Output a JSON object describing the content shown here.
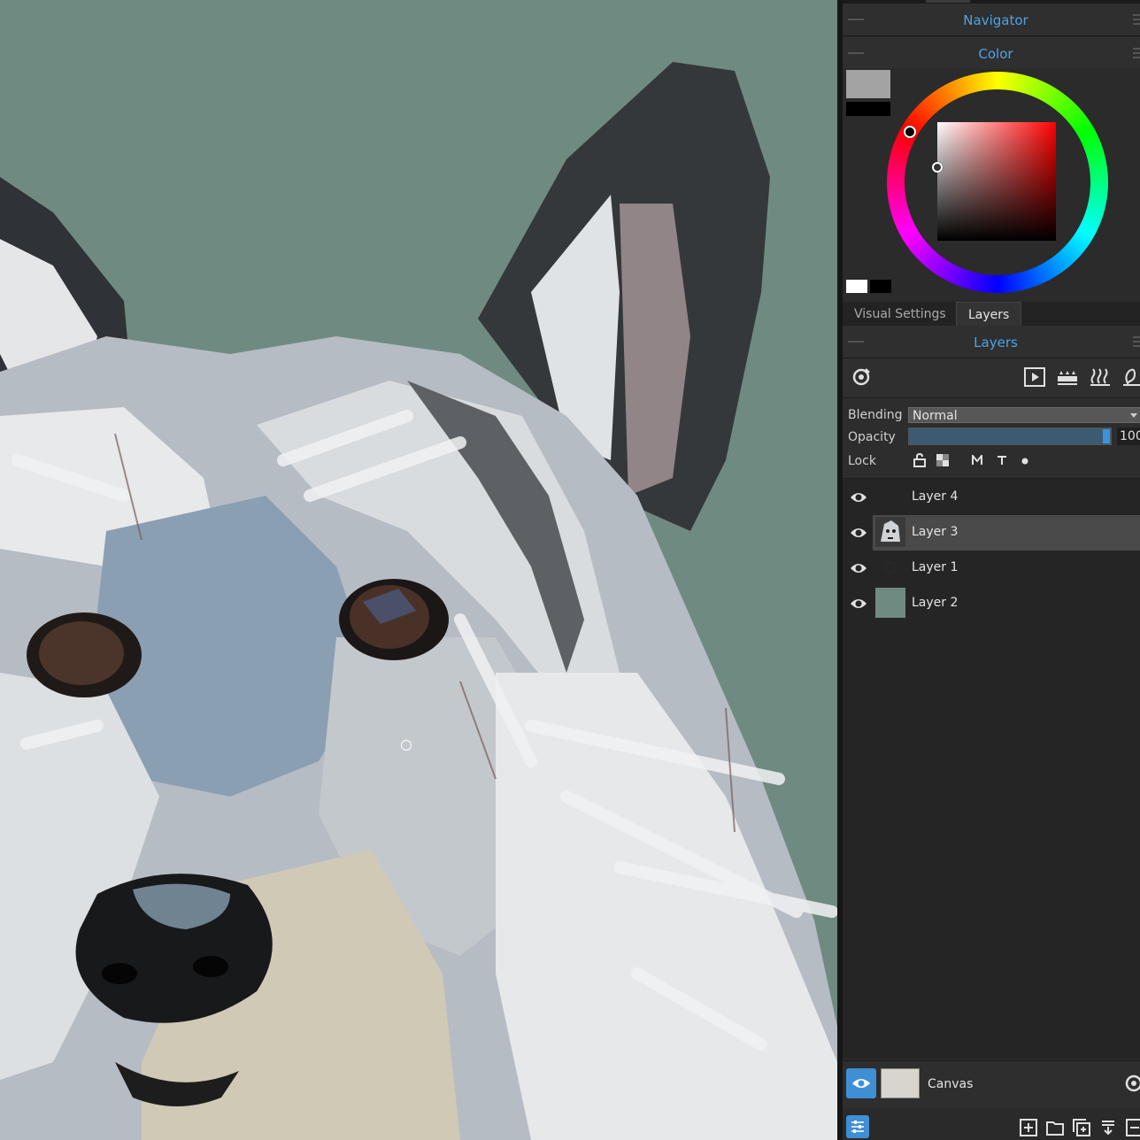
{
  "navigator": {
    "title": "Navigator"
  },
  "color": {
    "title": "Color",
    "main_swatch": "#a3a3a3",
    "secondary_swatch": "#000000"
  },
  "tabs": [
    {
      "label": "Visual Settings"
    },
    {
      "label": "Layers"
    }
  ],
  "layers_panel": {
    "title": "Layers",
    "blending_label": "Blending",
    "blending_value": "Normal",
    "opacity_label": "Opacity",
    "opacity_value": "100",
    "lock_label": "Lock",
    "layers": [
      {
        "name": "Layer 4",
        "selected": false
      },
      {
        "name": "Layer 3",
        "selected": true
      },
      {
        "name": "Layer 1",
        "selected": false
      },
      {
        "name": "Layer 2",
        "selected": false
      }
    ],
    "canvas_label": "Canvas"
  },
  "colors": {
    "accent": "#4ea3e6",
    "canvas_bg": "#6f8b81",
    "selected_row": "#4a4a4a"
  }
}
